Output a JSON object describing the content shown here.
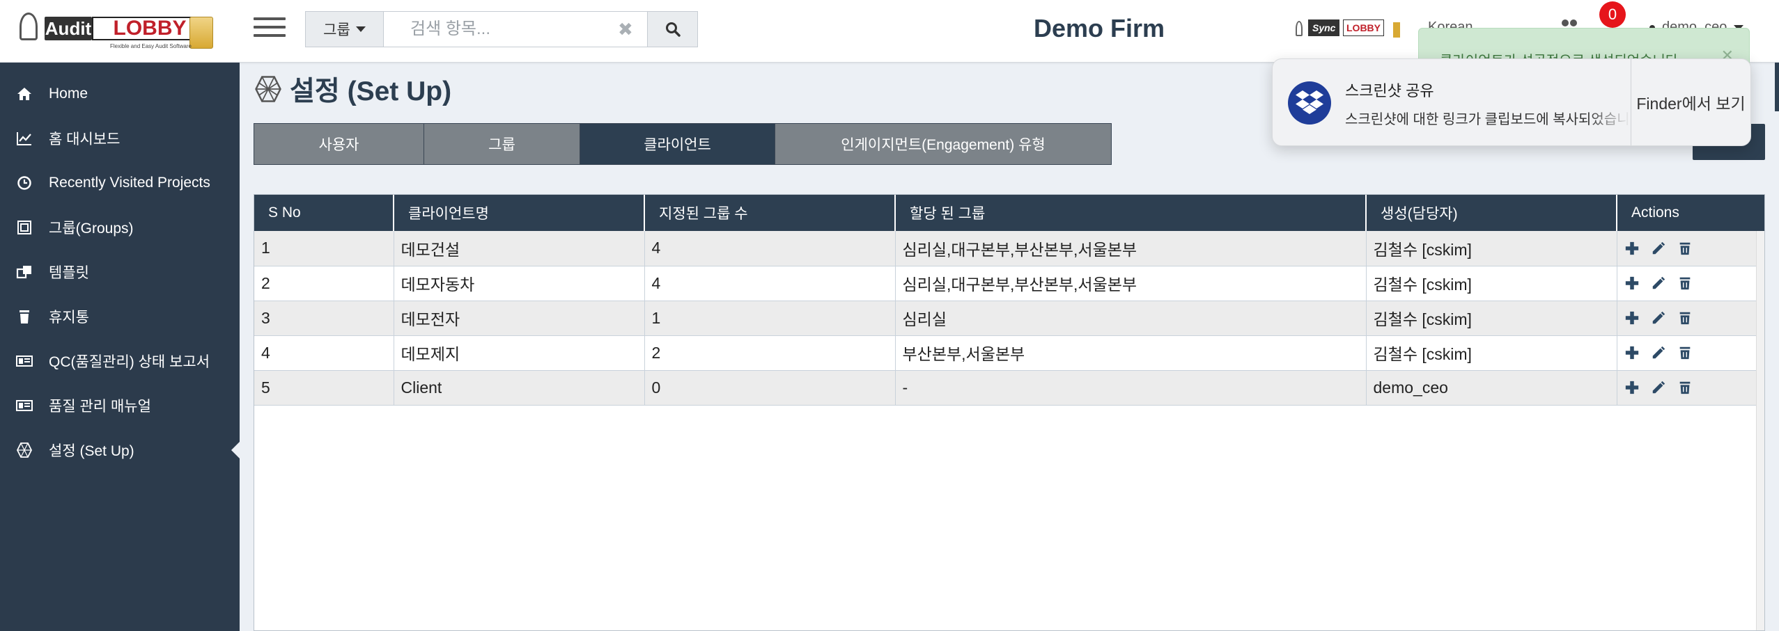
{
  "header": {
    "logo_audit": "Audit",
    "logo_lobby": "LOBBY",
    "logo_tagline": "Flexible and Easy Audit Software",
    "search_dropdown": "그룹",
    "search_placeholder": "검색 항목...",
    "firm_name": "Demo Firm",
    "sync_logo_sync": "Sync",
    "sync_logo_lobby": "LOBBY",
    "language": "Korean",
    "notification_count": "0",
    "user": "demo_ceo"
  },
  "sidebar": {
    "items": [
      {
        "label": "Home",
        "icon": "home-icon"
      },
      {
        "label": "홈 대시보드",
        "icon": "chart-icon"
      },
      {
        "label": "Recently Visited Projects",
        "icon": "clock-icon"
      },
      {
        "label": "그룹(Groups)",
        "icon": "group-icon"
      },
      {
        "label": "템플릿",
        "icon": "template-icon"
      },
      {
        "label": "휴지통",
        "icon": "trash-icon"
      },
      {
        "label": "QC(품질관리) 상태 보고서",
        "icon": "report-icon"
      },
      {
        "label": "품질 관리 매뉴얼",
        "icon": "manual-icon"
      },
      {
        "label": "설정 (Set Up)",
        "icon": "setup-icon",
        "active": true
      }
    ]
  },
  "main": {
    "title": "설정 (Set Up)",
    "tabs": [
      {
        "label": "사용자",
        "active": false
      },
      {
        "label": "그룹",
        "active": false
      },
      {
        "label": "클라이언트",
        "active": true
      },
      {
        "label": "인게이지먼트(Engagement) 유형",
        "active": false
      }
    ],
    "table": {
      "columns": [
        "S No",
        "클라이언트명",
        "지정된 그룹 수",
        "할당 된 그룹",
        "생성(담당자)",
        "Actions"
      ],
      "rows": [
        [
          "1",
          "데모건설",
          "4",
          "심리실,대구본부,부산본부,서울본부",
          "김철수 [cskim]"
        ],
        [
          "2",
          "데모자동차",
          "4",
          "심리실,대구본부,부산본부,서울본부",
          "김철수 [cskim]"
        ],
        [
          "3",
          "데모전자",
          "1",
          "심리실",
          "김철수 [cskim]"
        ],
        [
          "4",
          "데모제지",
          "2",
          "부산본부,서울본부",
          "김철수 [cskim]"
        ],
        [
          "5",
          "Client",
          "0",
          "-",
          "demo_ceo"
        ]
      ]
    }
  },
  "toasts": {
    "success_message": "클라이언트가 성공적으로 생성되었습니다.",
    "dropbox_title": "스크린샷 공유",
    "dropbox_body": "스크린샷에 대한 링크가 클립보드에 복사되었습니다.",
    "dropbox_action": "Finder에서 보기"
  },
  "colors": {
    "sidebar_bg": "#2c3b4c",
    "header_dark": "#2d3f51",
    "tab_inactive": "#7c8389",
    "badge_red": "#e6151b",
    "dropbox_blue": "#1f3d99"
  }
}
